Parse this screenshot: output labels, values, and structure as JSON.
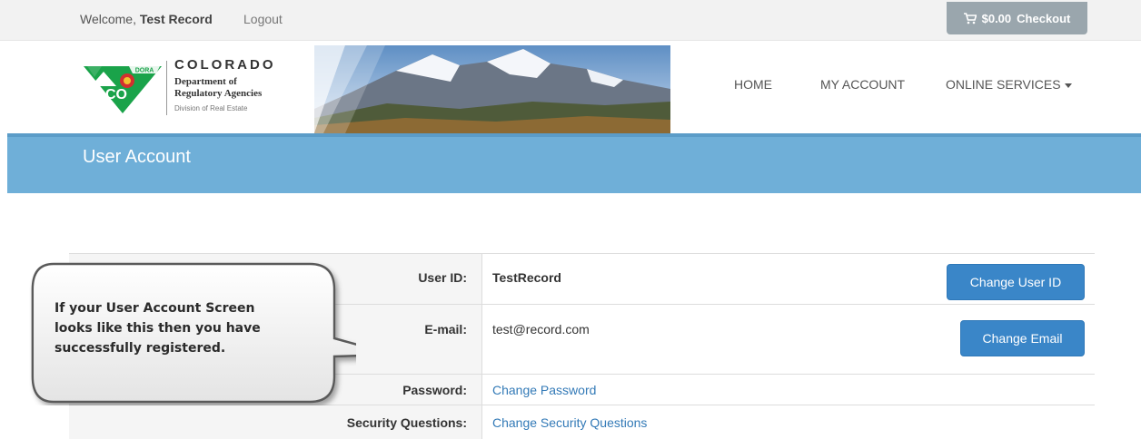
{
  "topbar": {
    "welcome_prefix": "Welcome, ",
    "user_name": "Test Record",
    "logout_label": "Logout",
    "checkout_amount": "$0.00",
    "checkout_label": "Checkout"
  },
  "brand": {
    "logo_badge": "DORA",
    "logo_initials": "CO",
    "state": "COLORADO",
    "dept_line1": "Department of",
    "dept_line2": "Regulatory Agencies",
    "division": "Division of Real Estate"
  },
  "nav": {
    "home": "HOME",
    "my_account": "MY ACCOUNT",
    "online_services": "ONLINE SERVICES"
  },
  "page": {
    "title": "User Account"
  },
  "account": {
    "user_id_label": "User ID:",
    "user_id_value": "TestRecord",
    "change_user_id": "Change User ID",
    "email_label": "E-mail:",
    "email_value": "test@record.com",
    "change_email": "Change Email",
    "password_label": "Password:",
    "change_password": "Change Password",
    "security_label": "Security Questions:",
    "change_security": "Change Security Questions"
  },
  "callout": {
    "line1": "If your User Account Screen",
    "line2": "looks like this then you have",
    "line3": "successfully registered."
  },
  "colors": {
    "title_band": "#6fafd8",
    "primary_button": "#3a86c8",
    "link": "#337ab7",
    "logo_green": "#1aa34a",
    "logo_red": "#d32f2f"
  }
}
